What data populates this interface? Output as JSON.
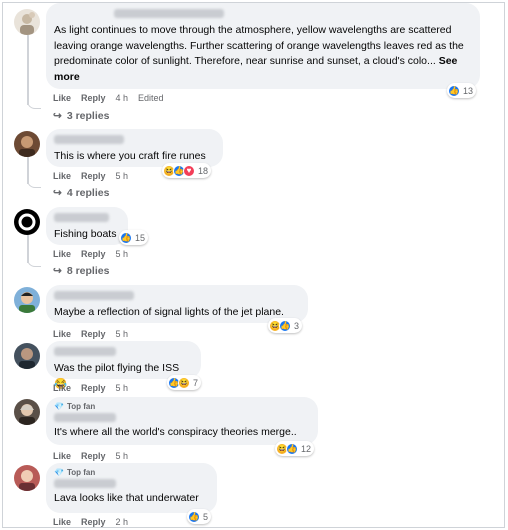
{
  "actions": {
    "like": "Like",
    "reply": "Reply"
  },
  "comments": [
    {
      "text": "As light continues to move through the atmosphere, yellow wavelengths are scattered leaving orange wavelengths. Further scattering of orange wavelengths leaves red as the predominate color of sunlight. Therefore, near sunrise and sunset, a cloud's colo...",
      "see_more": "See more",
      "time": "4 h",
      "edited": "Edited",
      "reactions": [
        "like"
      ],
      "reaction_count": "13",
      "replies": "3 replies"
    },
    {
      "text": "This is where you craft fire runes",
      "time": "5 h",
      "reactions": [
        "haha",
        "like",
        "love"
      ],
      "reaction_count": "18",
      "replies": "4 replies"
    },
    {
      "text": "Fishing boats",
      "time": "5 h",
      "reactions": [
        "like"
      ],
      "reaction_count": "15",
      "replies": "8 replies"
    },
    {
      "text": "Maybe a reflection of signal lights of the jet plane.",
      "time": "5 h",
      "reactions": [
        "haha",
        "like"
      ],
      "reaction_count": "3"
    },
    {
      "text": "Was the pilot flying the ISS 😂",
      "time": "5 h",
      "reactions": [
        "like",
        "haha"
      ],
      "reaction_count": "7"
    },
    {
      "badge": "Top fan",
      "text": "It's where all the world's conspiracy theories merge..",
      "time": "5 h",
      "reactions": [
        "haha",
        "like"
      ],
      "reaction_count": "12"
    },
    {
      "badge": "Top fan",
      "text": "Lava looks like that underwater",
      "time": "2 h",
      "reactions": [
        "like"
      ],
      "reaction_count": "5"
    }
  ]
}
